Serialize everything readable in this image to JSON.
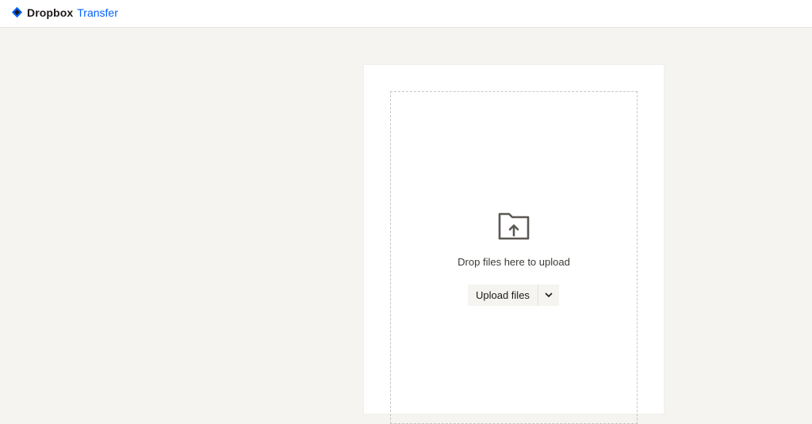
{
  "header": {
    "brand": "Dropbox",
    "product": "Transfer",
    "logo_icon": "dropbox-diamond-icon",
    "colors": {
      "brand_text": "#1e1919",
      "product_text": "#0061fe",
      "logo": "#0061fe"
    }
  },
  "dropzone": {
    "icon": "folder-upload-icon",
    "message": "Drop files here to upload",
    "upload_button_label": "Upload files",
    "menu_icon": "chevron-down-icon"
  },
  "colors": {
    "page_background": "#f5f4f0",
    "panel_background": "#ffffff",
    "dashed_border": "#c8c6c1"
  }
}
